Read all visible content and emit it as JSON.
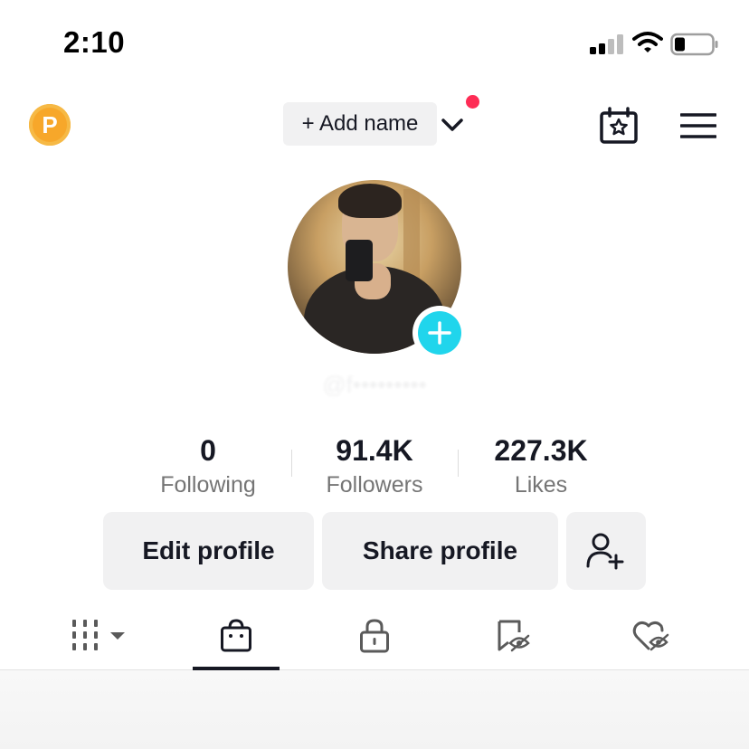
{
  "status_bar": {
    "time": "2:10"
  },
  "top_bar": {
    "coin_letter": "P",
    "add_name_label": "+ Add name"
  },
  "profile": {
    "username": "@f•••••••••"
  },
  "stats": [
    {
      "value": "0",
      "label": "Following"
    },
    {
      "value": "91.4K",
      "label": "Followers"
    },
    {
      "value": "227.3K",
      "label": "Likes"
    }
  ],
  "actions": {
    "edit_profile": "Edit profile",
    "share_profile": "Share profile"
  },
  "tabs": [
    {
      "icon": "grid-icon",
      "selected": false
    },
    {
      "icon": "shopping-bag-icon",
      "selected": true
    },
    {
      "icon": "lock-icon",
      "selected": false
    },
    {
      "icon": "hidden-bookmark-icon",
      "selected": false
    },
    {
      "icon": "hidden-heart-icon",
      "selected": false
    }
  ],
  "colors": {
    "accent_red": "#fe2c55",
    "badge_cyan": "#20d5ec",
    "coin_orange": "#f7a72a"
  }
}
